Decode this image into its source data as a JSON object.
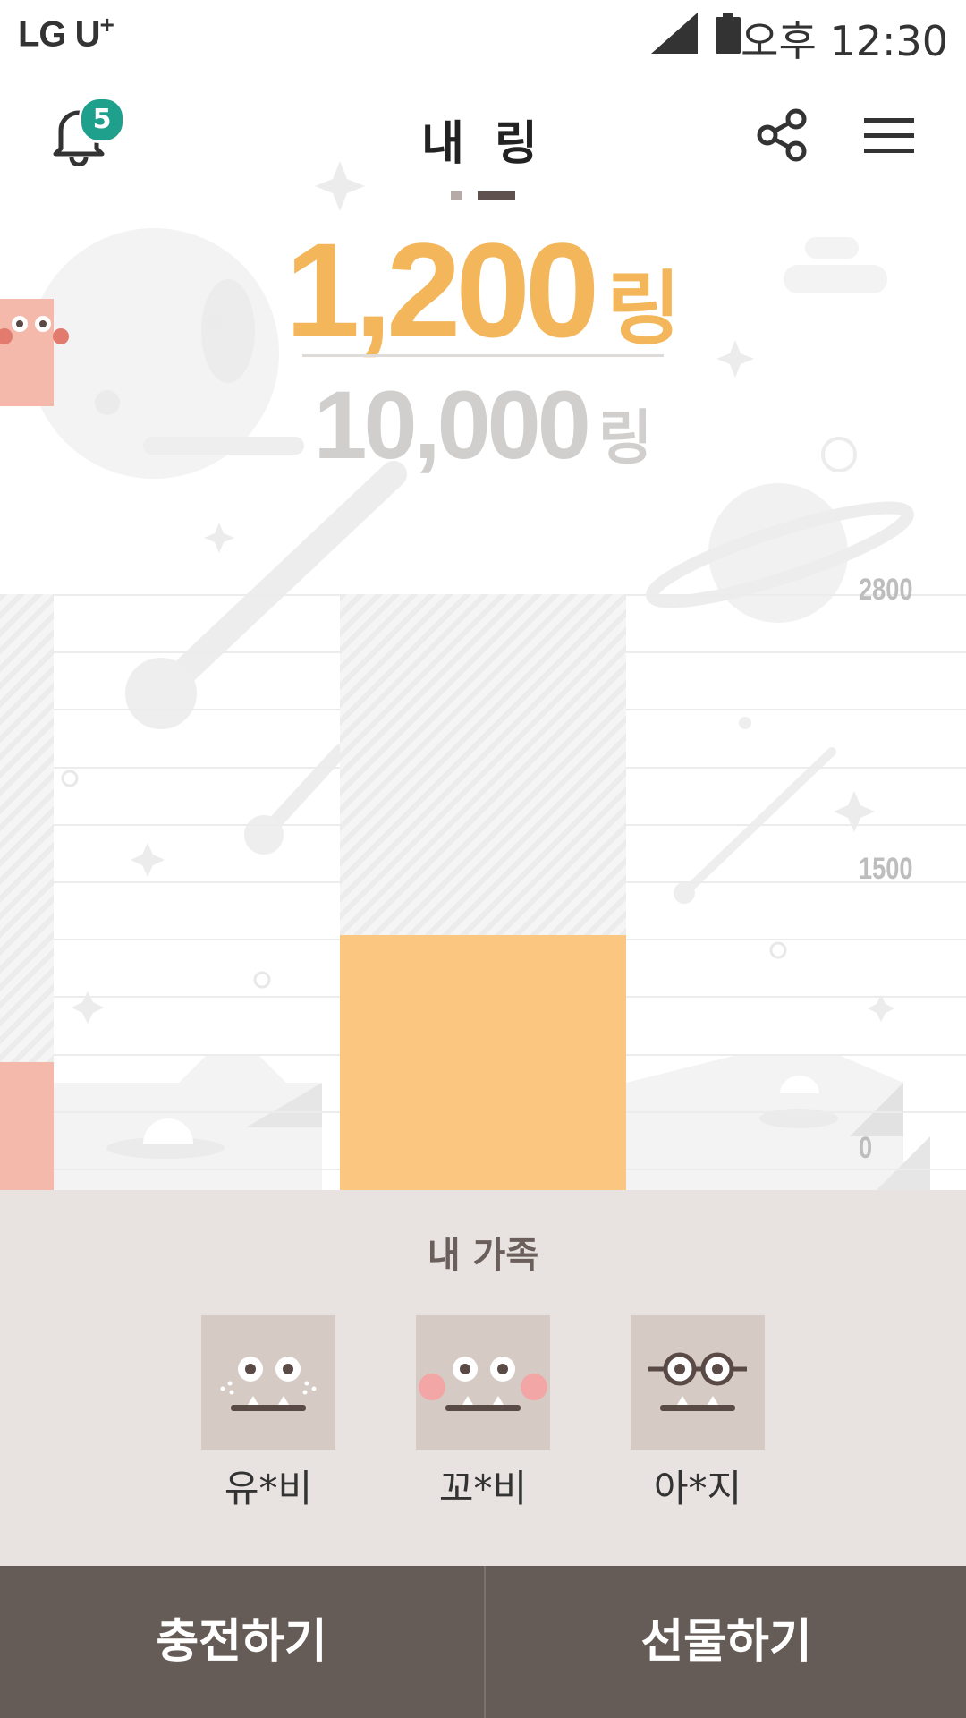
{
  "status_bar": {
    "carrier": "LG U",
    "carrier_plus": "+",
    "time": "오후 12:30"
  },
  "header": {
    "title": "내 링",
    "notification_count": "5"
  },
  "ring": {
    "current_value": "1,200",
    "current_unit": "링",
    "total_value": "10,000",
    "total_unit": "링"
  },
  "chart_data": {
    "type": "bar",
    "y_ticks": [
      "2800",
      "1500",
      "0"
    ],
    "ylim": [
      0,
      2800
    ],
    "bars": [
      {
        "value": 600,
        "color": "#f4b9ab"
      },
      {
        "value": 1200,
        "color": "#fbc780"
      }
    ]
  },
  "family": {
    "title": "내 가족",
    "members": [
      {
        "name": "유*비"
      },
      {
        "name": "꼬*비"
      },
      {
        "name": "아*지"
      }
    ]
  },
  "actions": {
    "charge_label": "충전하기",
    "gift_label": "선물하기"
  },
  "colors": {
    "accent": "#f3b65a",
    "badge": "#1ea08c",
    "button_bg": "#665c57",
    "family_bg": "#e8e3e0"
  },
  "icons": [
    "bell-icon",
    "share-icon",
    "menu-icon",
    "signal-icon",
    "battery-icon"
  ]
}
